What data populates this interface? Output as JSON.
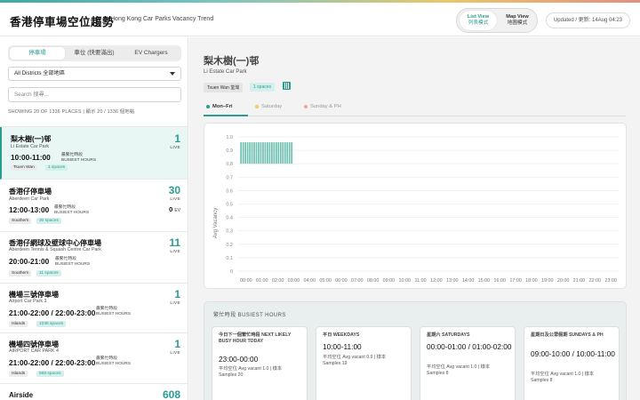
{
  "header": {
    "title": "香港停車場空位趨勢",
    "subtitle": "Hong Kong Car Parks Vacancy Trend",
    "list_view_en": "List View",
    "list_view_zh": "列表模式",
    "map_view_en": "Map View",
    "map_view_zh": "地圖模式",
    "updated": "Updated / 更新: 14Aug 04:23"
  },
  "sidebar": {
    "tabs": [
      "停車場",
      "車位 (快要滿出)",
      "EV Chargers"
    ],
    "district": "All Districts 全部地區",
    "search_placeholder": "Search 搜尋...",
    "showing": "SHOWING 20 OF 1336 PLACES | 顯示 20 / 1336 個地點",
    "busiest_zh": "最繁忙時段",
    "busiest_en": "BUSIEST HOURS",
    "live_label": "LIVE",
    "ev_label": "EV",
    "items": [
      {
        "zh": "梨木樹(一)邨",
        "en": "Li Estate Car Park",
        "time": "10:00-11:00",
        "district": "Tsuen Wan",
        "spaces": "1 spaces",
        "live": "1"
      },
      {
        "zh": "香港仔停車場",
        "en": "Aberdeen Car Park",
        "time": "12:00-13:00",
        "district": "Southern",
        "spaces": "30 spaces",
        "live": "30",
        "ev": "0"
      },
      {
        "zh": "香港仔網球及壁球中心停車場",
        "en": "Aberdeen Tennis & Squash Centre Car Park",
        "time": "20:00-21:00",
        "district": "Southern",
        "spaces": "11 spaces",
        "live": "11"
      },
      {
        "zh": "機場三號停車場",
        "en": "Airport Car Park 3",
        "time": "21:00-22:00 / 22:00-23:00",
        "district": "Islands",
        "spaces": "1036 spaces",
        "live": "1"
      },
      {
        "zh": "機場四號停車場",
        "en": "AIRPORT CAR PARK 4",
        "time": "21:00-22:00 / 22:00-23:00",
        "district": "Islands",
        "spaces": "588 spaces",
        "live": "1"
      },
      {
        "zh": "Airside",
        "live": "608"
      }
    ]
  },
  "main": {
    "title": "梨木樹(一)邨",
    "subtitle": "Li Estate Car Park",
    "district": "Tsuen Wan 荃灣",
    "spaces": "1 spaces",
    "day_tabs": [
      "Mon–Fri",
      "Saturday",
      "Sunday & PH"
    ],
    "busy_title": "繁忙時段 BUSIEST HOURS",
    "busy_cards": [
      {
        "head": "今日下一個繁忙時段 NEXT LIKELY BUSY HOUR TODAY",
        "time": "23:00-00:00",
        "avg": "平均空位 Avg vacant 1.0 | 樣本",
        "samples": "Samples 20"
      },
      {
        "head": "平日 WEEKDAYS",
        "time": "10:00-11:00",
        "avg": "平均空位 Avg vacant 0.9 | 樣本",
        "samples": "Samples 19"
      },
      {
        "head": "星期六 SATURDAYS",
        "time": "00:00-01:00 / 01:00-02:00",
        "avg": "平均空位 Avg vacant 1.0 | 樣本",
        "samples": "Samples 8"
      },
      {
        "head": "星期日及公眾假期 SUNDAYS & PH",
        "time": "09:00-10:00 / 10:00-11:00",
        "avg": "平均空位 Avg vacant 1.0 | 樣本",
        "samples": "Samples 8"
      }
    ]
  },
  "colors": {
    "accent": "#2a9d8f",
    "bar": "#6fbfb3",
    "saturday": "#f2c96b",
    "sunday": "#f0a0a0"
  },
  "chart_data": {
    "type": "bar",
    "ylabel": "Avg Vacancy",
    "ylim": [
      0,
      1.0
    ],
    "yticks": [
      "0",
      "0.1",
      "0.2",
      "0.3",
      "0.4",
      "0.5",
      "0.6",
      "0.7",
      "0.8",
      "0.9",
      "1.0"
    ],
    "categories": [
      "00:00",
      "01:00",
      "02:00",
      "03:00",
      "04:00",
      "05:00",
      "06:00",
      "07:00",
      "08:00",
      "09:00",
      "10:00",
      "11:00",
      "12:00",
      "13:00",
      "14:00",
      "15:00",
      "16:00",
      "17:00",
      "18:00",
      "19:00",
      "20:00",
      "21:00",
      "22:00",
      "23:00"
    ],
    "bars": [
      0.96,
      0.8,
      0.8,
      0.8,
      0.8,
      0.8,
      0.96,
      0.8,
      0.8,
      0.8,
      0.8,
      0.8,
      0.96,
      0.8,
      0.8,
      0.8,
      0.8,
      0.8,
      0.96,
      0.8,
      0.8,
      0.8,
      0.8,
      0.8,
      0.96,
      0.8,
      0.8,
      0.8,
      0.8,
      0.8,
      0.96,
      0.8,
      0.8,
      0.8,
      0.8,
      0.8,
      0.96,
      0.8,
      0.8,
      0.8,
      0.8,
      0.8,
      0.96,
      0.8,
      0.8,
      0.8,
      0.8,
      0.8,
      0.96,
      0.8,
      0.8,
      0.8,
      0.8,
      0.8,
      0.96,
      0.8,
      0.8,
      0.8,
      0.8,
      0.8,
      0.96,
      0.8,
      0.8,
      0.8,
      0.8,
      0.8,
      0.96,
      0.8,
      0.8,
      0.8,
      0.8,
      0.8
    ],
    "bar_range_hours": [
      0,
      3
    ]
  }
}
